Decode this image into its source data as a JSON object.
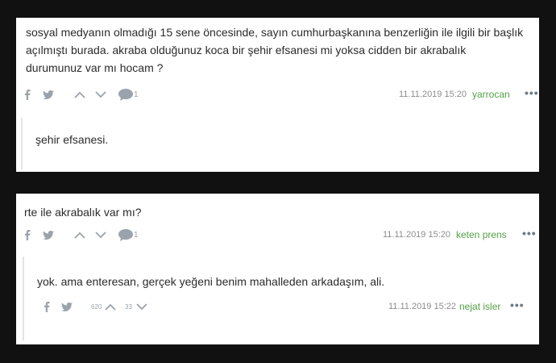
{
  "entries": [
    {
      "text": "sosyal medyanın olmadığı 15 sene öncesinde, sayın cumhurbaşkanına benzerliğin ile ilgili bir başlık açılmıştı burada. akraba olduğunuz koca bir şehir efsanesi mi yoksa cidden bir akrabalık durumunuz var mı hocam ?",
      "comment_count": "1",
      "date": "11.11.2019 15:20",
      "author": "yarrocan",
      "more": "•••",
      "reply": {
        "text": "şehir efsanesi."
      }
    },
    {
      "text": "rte ile akrabalık var mı?",
      "comment_count": "1",
      "date": "11.11.2019 15:20",
      "author": "keten prens",
      "more": "•••",
      "reply": {
        "text": "yok. ama enteresan, gerçek yeğeni benim mahalleden arkadaşım, ali.",
        "upvotes": "620",
        "downvotes": "33",
        "date": "11.11.2019 15:22",
        "author": "nejat isler",
        "more": "•••"
      }
    }
  ],
  "icons": [
    "facebook-icon",
    "twitter-icon",
    "upvote-chevron-icon",
    "downvote-chevron-icon",
    "comment-bubble-icon",
    "more-dots-icon"
  ],
  "colors": {
    "background": "#111111",
    "card": "#ffffff",
    "author": "#53a245",
    "icon": "#9aa3ab"
  }
}
